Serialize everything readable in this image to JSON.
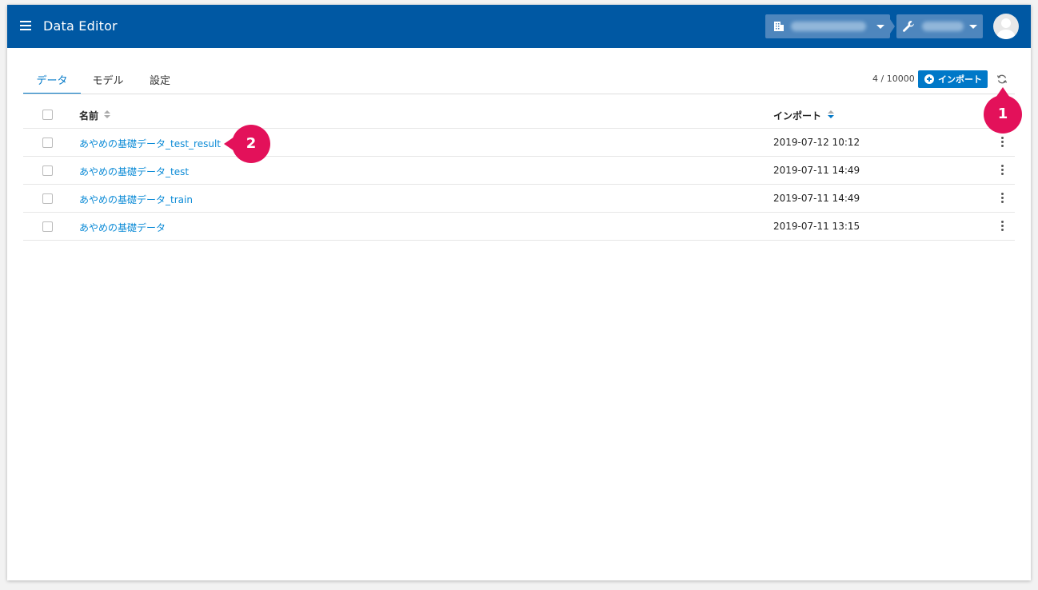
{
  "header": {
    "title": "Data Editor"
  },
  "tabs": [
    {
      "label": "データ",
      "active": true
    },
    {
      "label": "モデル",
      "active": false
    },
    {
      "label": "設定",
      "active": false
    }
  ],
  "toolbar": {
    "count": "4 / 10000",
    "import_label": "インポート"
  },
  "table": {
    "columns": {
      "name": "名前",
      "import": "インポート"
    },
    "rows": [
      {
        "name": "あやめの基礎データ_test_result",
        "import": "2019-07-12 10:12"
      },
      {
        "name": "あやめの基礎データ_test",
        "import": "2019-07-11 14:49"
      },
      {
        "name": "あやめの基礎データ_train",
        "import": "2019-07-11 14:49"
      },
      {
        "name": "あやめの基礎データ",
        "import": "2019-07-11 13:15"
      }
    ]
  },
  "callouts": {
    "one": "1",
    "two": "2"
  },
  "colors": {
    "appbar": "#0058a3",
    "accent": "#0078c8",
    "link": "#0a8ad6",
    "callout": "#e3115a"
  },
  "icons": [
    "menu-icon",
    "building-icon",
    "wrench-icon",
    "avatar-icon",
    "plus-circle-icon",
    "refresh-icon",
    "more-vert-icon",
    "sort-icon",
    "caret-down-icon"
  ]
}
